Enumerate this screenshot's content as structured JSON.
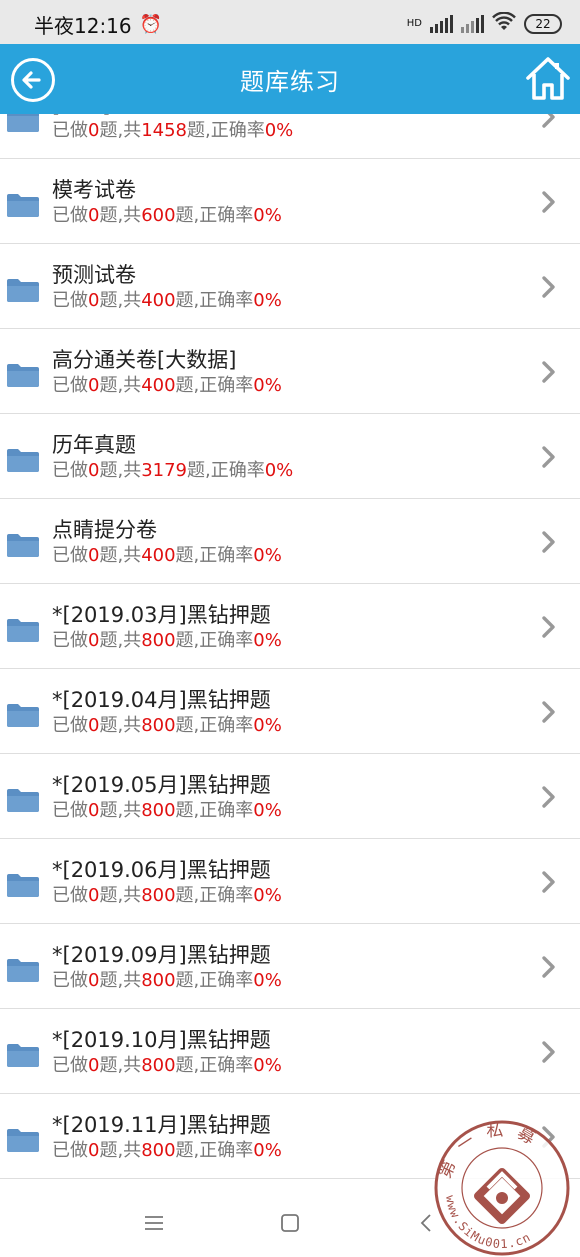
{
  "status": {
    "time": "半夜12:16",
    "battery": "22",
    "network_label": "HD"
  },
  "header": {
    "title": "题库练习"
  },
  "items": [
    {
      "title": "[备选]章节练习",
      "done_prefix": "已做",
      "done": "0",
      "mid": "题,共",
      "total": "1458",
      "suffix": "题,正确率",
      "rate": "0%"
    },
    {
      "title": "模考试卷",
      "done_prefix": "已做",
      "done": "0",
      "mid": "题,共",
      "total": "600",
      "suffix": "题,正确率",
      "rate": "0%"
    },
    {
      "title": "预测试卷",
      "done_prefix": "已做",
      "done": "0",
      "mid": "题,共",
      "total": "400",
      "suffix": "题,正确率",
      "rate": "0%"
    },
    {
      "title": "高分通关卷[大数据]",
      "done_prefix": "已做",
      "done": "0",
      "mid": "题,共",
      "total": "400",
      "suffix": "题,正确率",
      "rate": "0%"
    },
    {
      "title": "历年真题",
      "done_prefix": "已做",
      "done": "0",
      "mid": "题,共",
      "total": "3179",
      "suffix": "题,正确率",
      "rate": "0%"
    },
    {
      "title": "点睛提分卷",
      "done_prefix": "已做",
      "done": "0",
      "mid": "题,共",
      "total": "400",
      "suffix": "题,正确率",
      "rate": "0%"
    },
    {
      "title": "*[2019.03月]黑钻押题",
      "done_prefix": "已做",
      "done": "0",
      "mid": "题,共",
      "total": "800",
      "suffix": "题,正确率",
      "rate": "0%"
    },
    {
      "title": "*[2019.04月]黑钻押题",
      "done_prefix": "已做",
      "done": "0",
      "mid": "题,共",
      "total": "800",
      "suffix": "题,正确率",
      "rate": "0%"
    },
    {
      "title": "*[2019.05月]黑钻押题",
      "done_prefix": "已做",
      "done": "0",
      "mid": "题,共",
      "total": "800",
      "suffix": "题,正确率",
      "rate": "0%"
    },
    {
      "title": "*[2019.06月]黑钻押题",
      "done_prefix": "已做",
      "done": "0",
      "mid": "题,共",
      "total": "800",
      "suffix": "题,正确率",
      "rate": "0%"
    },
    {
      "title": "*[2019.09月]黑钻押题",
      "done_prefix": "已做",
      "done": "0",
      "mid": "题,共",
      "total": "800",
      "suffix": "题,正确率",
      "rate": "0%"
    },
    {
      "title": "*[2019.10月]黑钻押题",
      "done_prefix": "已做",
      "done": "0",
      "mid": "题,共",
      "total": "800",
      "suffix": "题,正确率",
      "rate": "0%"
    },
    {
      "title": "*[2019.11月]黑钻押题",
      "done_prefix": "已做",
      "done": "0",
      "mid": "题,共",
      "total": "800",
      "suffix": "题,正确率",
      "rate": "0%"
    }
  ],
  "watermark": {
    "top_text": "第一私募",
    "bottom_text": "www.SiMu001.cn"
  },
  "colors": {
    "app_bar": "#29a3dc",
    "highlight": "#e01010",
    "folder": "#5b8fc4"
  },
  "icons": {
    "back": "arrow-left-circle-icon",
    "home": "home-icon",
    "folder": "folder-icon",
    "chevron": "chevron-right-icon",
    "menu": "menu-icon",
    "square": "square-icon",
    "back_nav": "chevron-left-icon"
  }
}
